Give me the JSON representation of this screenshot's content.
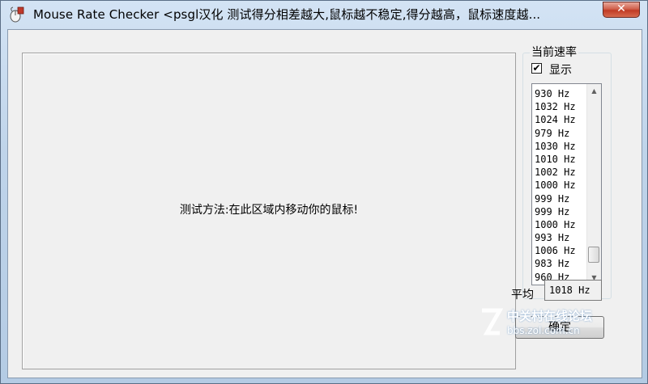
{
  "window": {
    "title": "Mouse Rate Checker <psgl汉化  测试得分相差越大,鼠标越不稳定,得分越高，鼠标速度越...",
    "close_glyph": "✕",
    "icon": "mouse-app-icon"
  },
  "test_area": {
    "instruction": "测试方法:在此区域内移动你的鼠标!"
  },
  "rate_panel": {
    "group_label": "当前速率",
    "show_label": "显示",
    "show_checked": true,
    "check_glyph": "✔",
    "rates": [
      "930 Hz",
      "1032 Hz",
      "1024 Hz",
      "979 Hz",
      "1030 Hz",
      "1010 Hz",
      "1002 Hz",
      "1000 Hz",
      "999 Hz",
      "999 Hz",
      "1000 Hz",
      "993 Hz",
      "1006 Hz",
      "983 Hz",
      "960 Hz"
    ],
    "scroll_up_glyph": "▲",
    "scroll_down_glyph": "▼"
  },
  "average": {
    "label": "平均",
    "value": "1018 Hz"
  },
  "ok_button": {
    "label": "确定"
  },
  "watermark": {
    "line1": "中关村在线论坛",
    "line2": "bbs.zol.com.cn"
  }
}
